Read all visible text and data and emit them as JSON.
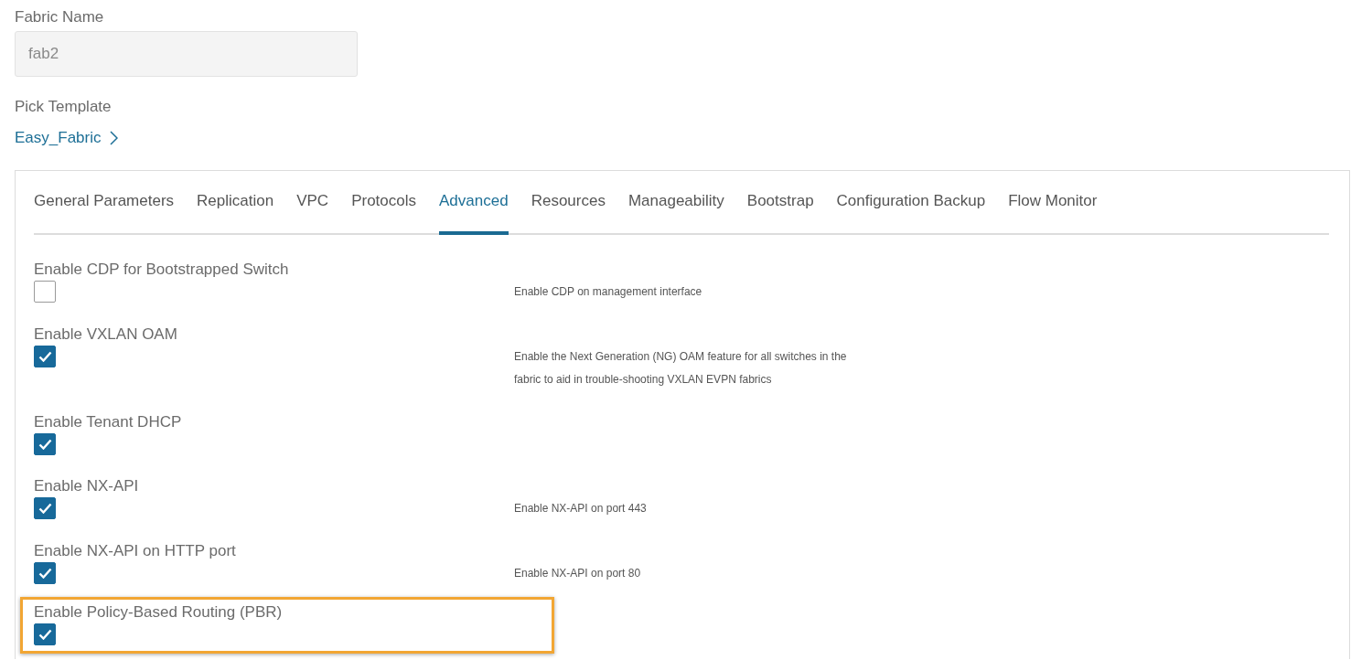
{
  "fabric_name": {
    "label": "Fabric Name",
    "value": "fab2",
    "disabled": true
  },
  "template": {
    "label": "Pick Template",
    "link": "Easy_Fabric"
  },
  "tabs": [
    {
      "label": "General Parameters",
      "selected": false
    },
    {
      "label": "Replication",
      "selected": false
    },
    {
      "label": "VPC",
      "selected": false
    },
    {
      "label": "Protocols",
      "selected": false
    },
    {
      "label": "Advanced",
      "selected": true
    },
    {
      "label": "Resources",
      "selected": false
    },
    {
      "label": "Manageability",
      "selected": false
    },
    {
      "label": "Bootstrap",
      "selected": false
    },
    {
      "label": "Configuration Backup",
      "selected": false
    },
    {
      "label": "Flow Monitor",
      "selected": false
    }
  ],
  "settings": [
    {
      "label": "Enable CDP for Bootstrapped Switch",
      "checked": false,
      "description": "Enable CDP on management interface",
      "highlighted": false
    },
    {
      "label": "Enable VXLAN OAM",
      "checked": true,
      "description": "Enable the Next Generation (NG) OAM feature for all switches in the fabric to aid in trouble-shooting VXLAN EVPN fabrics",
      "highlighted": false
    },
    {
      "label": "Enable Tenant DHCP",
      "checked": true,
      "highlighted": false
    },
    {
      "label": "Enable NX-API",
      "checked": true,
      "description": "Enable NX-API on port 443",
      "highlighted": false
    },
    {
      "label": "Enable NX-API on HTTP port",
      "checked": true,
      "description": "Enable NX-API on port 80",
      "highlighted": false
    },
    {
      "label": "Enable Policy-Based Routing (PBR)",
      "checked": true,
      "highlighted": true
    }
  ]
}
